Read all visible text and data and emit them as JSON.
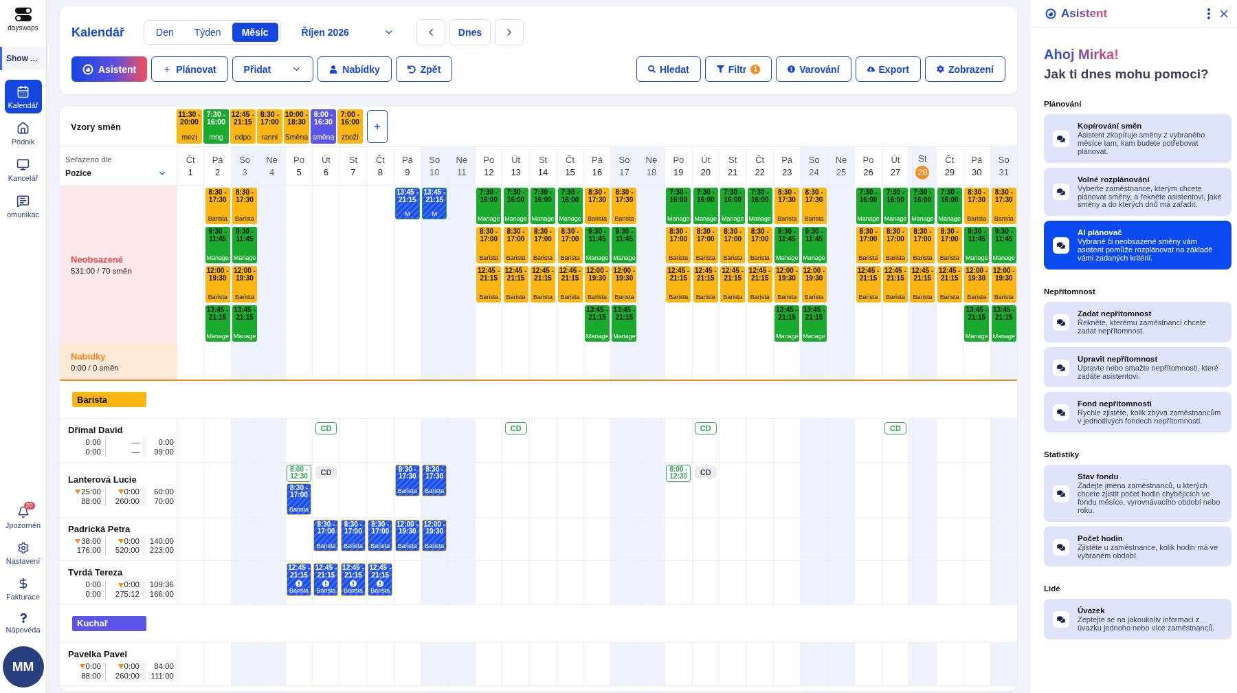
{
  "sidebar": {
    "logo": "dayswaps",
    "workspace": "Show ...",
    "items": [
      {
        "label": "Kalendář",
        "selected": true
      },
      {
        "label": "Podnik",
        "selected": false
      },
      {
        "label": "Kancelář",
        "selected": false
      },
      {
        "label": "omunikac",
        "selected": false
      }
    ],
    "bottom_items": [
      {
        "label": "Jpozorněn",
        "badge": "20"
      },
      {
        "label": "Nastavení"
      },
      {
        "label": "Fakturace"
      },
      {
        "label": "Nápověda"
      }
    ],
    "avatar": "MM"
  },
  "header": {
    "title": "Kalendář",
    "view_tabs": [
      {
        "label": "Den",
        "selected": false
      },
      {
        "label": "Týden",
        "selected": false
      },
      {
        "label": "Měsíc",
        "selected": true
      }
    ],
    "month": "Říjen 2026",
    "today_button": "Dnes",
    "actions_left": [
      {
        "label": "Asistent",
        "kind": "gradient"
      },
      {
        "label": "Plánovat",
        "kind": "plain"
      },
      {
        "label": "Přidat",
        "kind": "dropdown"
      },
      {
        "label": "Nabídky",
        "kind": "plain"
      },
      {
        "label": "Zpět",
        "kind": "plain"
      }
    ],
    "actions_right": [
      {
        "label": "Hledat"
      },
      {
        "label": "Filtr",
        "badge": "1"
      },
      {
        "label": "Varování"
      },
      {
        "label": "Export"
      },
      {
        "label": "Zobrazení"
      }
    ]
  },
  "calendar": {
    "patterns_label": "Vzory směn",
    "patterns": [
      {
        "time": "11:30 - 20:00",
        "name": "mezi",
        "color": "#fbb614"
      },
      {
        "time": "7:30 - 16:00",
        "name": "mng",
        "color": "#1aab2e"
      },
      {
        "time": "12:45 - 21:15",
        "name": "odpo",
        "color": "#fbb614"
      },
      {
        "time": "8:30 - 17:00",
        "name": "ranní",
        "color": "#fbb614"
      },
      {
        "time": "10:00 - 18:30",
        "name": "Směna",
        "color": "#fbb614"
      },
      {
        "time": "8:00 - 16:30",
        "name": "směna",
        "color": "#5b55ea"
      },
      {
        "time": "7:00 - 16:00",
        "name": "zboží",
        "color": "#fbb614"
      }
    ],
    "sort_label": "Seřazeno dle",
    "sort_value": "Pozice",
    "days": [
      {
        "weekday": "Čt",
        "date": "1",
        "weekend": false,
        "today": false
      },
      {
        "weekday": "Pá",
        "date": "2",
        "weekend": false,
        "today": false,
        "unfilled": [
          {
            "kind": "chip",
            "color": "#fbb614",
            "time": "8:30 - 17:30",
            "role": "Barista"
          },
          {
            "kind": "chip",
            "color": "#1aab2e",
            "time": "9:30 - 11:45",
            "role": "Manage"
          },
          {
            "kind": "chip",
            "color": "#fbb614",
            "time": "12:00 - 19:30",
            "role": "Barista"
          },
          {
            "kind": "chip",
            "color": "#1aab2e",
            "time": "13:45 - 21:15",
            "role": "Manage"
          }
        ]
      },
      {
        "weekday": "So",
        "date": "3",
        "weekend": true,
        "today": false,
        "unfilled": [
          {
            "kind": "chip",
            "color": "#fbb614",
            "time": "8:30 - 17:30",
            "role": "Barista"
          },
          {
            "kind": "chip",
            "color": "#1aab2e",
            "time": "9:30 - 11:45",
            "role": "Manage"
          },
          {
            "kind": "chip",
            "color": "#fbb614",
            "time": "12:00 - 19:30",
            "role": "Barista"
          },
          {
            "kind": "chip",
            "color": "#1aab2e",
            "time": "13:45 - 21:15",
            "role": "Manage"
          }
        ]
      },
      {
        "weekday": "Ne",
        "date": "4",
        "weekend": true,
        "today": false
      },
      {
        "weekday": "Po",
        "date": "5",
        "weekend": false,
        "today": false
      },
      {
        "weekday": "Út",
        "date": "6",
        "weekend": false,
        "today": false
      },
      {
        "weekday": "St",
        "date": "7",
        "weekend": false,
        "today": false
      },
      {
        "weekday": "Čt",
        "date": "8",
        "weekend": false,
        "today": false
      },
      {
        "weekday": "Pá",
        "date": "9",
        "weekend": false,
        "today": false,
        "unfilled": [
          {
            "kind": "striped",
            "color": "#19a83a",
            "time": "13:45 - 21:15",
            "role": "M",
            "warning": false
          }
        ]
      },
      {
        "weekday": "So",
        "date": "10",
        "weekend": true,
        "today": false,
        "unfilled": [
          {
            "kind": "striped",
            "color": "#19a83a",
            "time": "13:45 - 21:15",
            "role": "M",
            "warning": false
          }
        ]
      },
      {
        "weekday": "Ne",
        "date": "11",
        "weekend": true,
        "today": false
      },
      {
        "weekday": "Po",
        "date": "12",
        "weekend": false,
        "today": false,
        "unfilled": [
          {
            "kind": "chip",
            "color": "#1aab2e",
            "time": "7:30 - 16:00",
            "role": "Manage"
          },
          {
            "kind": "chip",
            "color": "#fbb614",
            "time": "8:30 - 17:00",
            "role": "Barista"
          },
          {
            "kind": "chip",
            "color": "#fbb614",
            "time": "12:45 - 21:15",
            "role": "Barista"
          }
        ]
      },
      {
        "weekday": "Út",
        "date": "13",
        "weekend": false,
        "today": false,
        "unfilled": [
          {
            "kind": "chip",
            "color": "#1aab2e",
            "time": "7:30 - 16:00",
            "role": "Manage"
          },
          {
            "kind": "chip",
            "color": "#fbb614",
            "time": "8:30 - 17:00",
            "role": "Barista"
          },
          {
            "kind": "chip",
            "color": "#fbb614",
            "time": "12:45 - 21:15",
            "role": "Barista"
          }
        ]
      },
      {
        "weekday": "St",
        "date": "14",
        "weekend": false,
        "today": false,
        "unfilled": [
          {
            "kind": "chip",
            "color": "#1aab2e",
            "time": "7:30 - 16:00",
            "role": "Manage"
          },
          {
            "kind": "chip",
            "color": "#fbb614",
            "time": "8:30 - 17:00",
            "role": "Barista"
          },
          {
            "kind": "chip",
            "color": "#fbb614",
            "time": "12:45 - 21:15",
            "role": "Barista"
          }
        ]
      },
      {
        "weekday": "Čt",
        "date": "15",
        "weekend": false,
        "today": false,
        "unfilled": [
          {
            "kind": "chip",
            "color": "#1aab2e",
            "time": "7:30 - 16:00",
            "role": "Manage"
          },
          {
            "kind": "chip",
            "color": "#fbb614",
            "time": "8:30 - 17:00",
            "role": "Barista"
          },
          {
            "kind": "chip",
            "color": "#fbb614",
            "time": "12:45 - 21:15",
            "role": "Barista"
          }
        ]
      },
      {
        "weekday": "Pá",
        "date": "16",
        "weekend": false,
        "today": false,
        "unfilled": [
          {
            "kind": "chip",
            "color": "#fbb614",
            "time": "8:30 - 17:30",
            "role": "Barista"
          },
          {
            "kind": "chip",
            "color": "#1aab2e",
            "time": "9:30 - 11:45",
            "role": "Manage"
          },
          {
            "kind": "chip",
            "color": "#fbb614",
            "time": "12:00 - 19:30",
            "role": "Barista"
          },
          {
            "kind": "chip",
            "color": "#1aab2e",
            "time": "13:45 - 21:15",
            "role": "Manage"
          }
        ]
      },
      {
        "weekday": "So",
        "date": "17",
        "weekend": true,
        "today": false,
        "unfilled": [
          {
            "kind": "chip",
            "color": "#fbb614",
            "time": "8:30 - 17:30",
            "role": "Barista"
          },
          {
            "kind": "chip",
            "color": "#1aab2e",
            "time": "9:30 - 11:45",
            "role": "Manage"
          },
          {
            "kind": "chip",
            "color": "#fbb614",
            "time": "12:00 - 19:30",
            "role": "Barista"
          },
          {
            "kind": "chip",
            "color": "#1aab2e",
            "time": "13:45 - 21:15",
            "role": "Manage"
          }
        ]
      },
      {
        "weekday": "Ne",
        "date": "18",
        "weekend": true,
        "today": false
      },
      {
        "weekday": "Po",
        "date": "19",
        "weekend": false,
        "today": false,
        "unfilled": [
          {
            "kind": "chip",
            "color": "#1aab2e",
            "time": "7:30 - 16:00",
            "role": "Manage"
          },
          {
            "kind": "chip",
            "color": "#fbb614",
            "time": "8:30 - 17:00",
            "role": "Barista"
          },
          {
            "kind": "chip",
            "color": "#fbb614",
            "time": "12:45 - 21:15",
            "role": "Barista"
          }
        ]
      },
      {
        "weekday": "Út",
        "date": "20",
        "weekend": false,
        "today": false,
        "unfilled": [
          {
            "kind": "chip",
            "color": "#1aab2e",
            "time": "7:30 - 16:00",
            "role": "Manage"
          },
          {
            "kind": "chip",
            "color": "#fbb614",
            "time": "8:30 - 17:00",
            "role": "Barista"
          },
          {
            "kind": "chip",
            "color": "#fbb614",
            "time": "12:45 - 21:15",
            "role": "Barista"
          }
        ]
      },
      {
        "weekday": "St",
        "date": "21",
        "weekend": false,
        "today": false,
        "unfilled": [
          {
            "kind": "chip",
            "color": "#1aab2e",
            "time": "7:30 - 16:00",
            "role": "Manage"
          },
          {
            "kind": "chip",
            "color": "#fbb614",
            "time": "8:30 - 17:00",
            "role": "Barista"
          },
          {
            "kind": "chip",
            "color": "#fbb614",
            "time": "12:45 - 21:15",
            "role": "Barista"
          }
        ]
      },
      {
        "weekday": "Čt",
        "date": "22",
        "weekend": false,
        "today": false,
        "unfilled": [
          {
            "kind": "chip",
            "color": "#1aab2e",
            "time": "7:30 - 16:00",
            "role": "Manage"
          },
          {
            "kind": "chip",
            "color": "#fbb614",
            "time": "8:30 - 17:00",
            "role": "Barista"
          },
          {
            "kind": "chip",
            "color": "#fbb614",
            "time": "12:45 - 21:15",
            "role": "Barista"
          }
        ]
      },
      {
        "weekday": "Pá",
        "date": "23",
        "weekend": false,
        "today": false,
        "unfilled": [
          {
            "kind": "chip",
            "color": "#fbb614",
            "time": "8:30 - 17:30",
            "role": "Barista"
          },
          {
            "kind": "chip",
            "color": "#1aab2e",
            "time": "9:30 - 11:45",
            "role": "Manage"
          },
          {
            "kind": "chip",
            "color": "#fbb614",
            "time": "12:00 - 19:30",
            "role": "Barista"
          },
          {
            "kind": "chip",
            "color": "#1aab2e",
            "time": "13:45 - 21:15",
            "role": "Manage"
          }
        ]
      },
      {
        "weekday": "So",
        "date": "24",
        "weekend": true,
        "today": false,
        "unfilled": [
          {
            "kind": "chip",
            "color": "#fbb614",
            "time": "8:30 - 17:30",
            "role": "Barista"
          },
          {
            "kind": "chip",
            "color": "#1aab2e",
            "time": "9:30 - 11:45",
            "role": "Manage"
          },
          {
            "kind": "chip",
            "color": "#fbb614",
            "time": "12:00 - 19:30",
            "role": "Barista"
          },
          {
            "kind": "chip",
            "color": "#1aab2e",
            "time": "13:45 - 21:15",
            "role": "Manage"
          }
        ]
      },
      {
        "weekday": "Ne",
        "date": "25",
        "weekend": true,
        "today": false
      },
      {
        "weekday": "Po",
        "date": "26",
        "weekend": false,
        "today": false,
        "unfilled": [
          {
            "kind": "chip",
            "color": "#1aab2e",
            "time": "7:30 - 16:00",
            "role": "Manage"
          },
          {
            "kind": "chip",
            "color": "#fbb614",
            "time": "8:30 - 17:00",
            "role": "Barista"
          },
          {
            "kind": "chip",
            "color": "#fbb614",
            "time": "12:45 - 21:15",
            "role": "Barista"
          }
        ]
      },
      {
        "weekday": "Út",
        "date": "27",
        "weekend": false,
        "today": false,
        "unfilled": [
          {
            "kind": "chip",
            "color": "#1aab2e",
            "time": "7:30 - 16:00",
            "role": "Manage"
          },
          {
            "kind": "chip",
            "color": "#fbb614",
            "time": "8:30 - 17:00",
            "role": "Barista"
          },
          {
            "kind": "chip",
            "color": "#fbb614",
            "time": "12:45 - 21:15",
            "role": "Barista"
          }
        ]
      },
      {
        "weekday": "St",
        "date": "28",
        "weekend": false,
        "today": true,
        "unfilled": [
          {
            "kind": "chip",
            "color": "#1aab2e",
            "time": "7:30 - 16:00",
            "role": "Manage"
          },
          {
            "kind": "chip",
            "color": "#fbb614",
            "time": "8:30 - 17:00",
            "role": "Barista"
          },
          {
            "kind": "chip",
            "color": "#fbb614",
            "time": "12:45 - 21:15",
            "role": "Barista"
          }
        ]
      },
      {
        "weekday": "Čt",
        "date": "29",
        "weekend": false,
        "today": false,
        "unfilled": [
          {
            "kind": "chip",
            "color": "#1aab2e",
            "time": "7:30 - 16:00",
            "role": "Manage"
          },
          {
            "kind": "chip",
            "color": "#fbb614",
            "time": "8:30 - 17:00",
            "role": "Barista"
          },
          {
            "kind": "chip",
            "color": "#fbb614",
            "time": "12:45 - 21:15",
            "role": "Barista"
          }
        ]
      },
      {
        "weekday": "Pá",
        "date": "30",
        "weekend": false,
        "today": false,
        "unfilled": [
          {
            "kind": "chip",
            "color": "#fbb614",
            "time": "8:30 - 17:30",
            "role": "Barista"
          },
          {
            "kind": "chip",
            "color": "#1aab2e",
            "time": "9:30 - 11:45",
            "role": "Manage"
          },
          {
            "kind": "chip",
            "color": "#fbb614",
            "time": "12:00 - 19:30",
            "role": "Barista"
          },
          {
            "kind": "chip",
            "color": "#1aab2e",
            "time": "13:45 - 21:15",
            "role": "Manage"
          }
        ]
      },
      {
        "weekday": "So",
        "date": "31",
        "weekend": true,
        "today": false,
        "unfilled": [
          {
            "kind": "chip",
            "color": "#fbb614",
            "time": "8:30 - 17:30",
            "role": "Barista"
          },
          {
            "kind": "chip",
            "color": "#1aab2e",
            "time": "9:30 - 11:45",
            "role": "Manage"
          },
          {
            "kind": "chip",
            "color": "#fbb614",
            "time": "12:00 - 19:30",
            "role": "Barista"
          },
          {
            "kind": "chip",
            "color": "#1aab2e",
            "time": "13:45 - 21:15",
            "role": "Manage"
          }
        ]
      }
    ],
    "unfilled": {
      "title": "Neobsazené",
      "summary": "531:00 / 70 směn"
    },
    "offers": {
      "title": "Nabídky",
      "summary": "0:00 / 0 směn"
    },
    "groups": [
      {
        "name": "Barista",
        "color": "#fbb614",
        "employees": [
          {
            "name": "Dřímal David",
            "stats": [
              {
                "top": "0:00",
                "bottom": "0:00",
                "flag": false
              },
              {
                "top": "—",
                "bottom": "—",
                "flag": false
              },
              {
                "top": "0:00",
                "bottom": "99:00",
                "flag": false
              }
            ],
            "cells": [
              {
                "kind": "free"
              },
              {
                "kind": "free"
              },
              {
                "kind": "free"
              },
              {
                "kind": "free"
              },
              {
                "kind": "free"
              },
              {
                "kind": "busy",
                "items": [
                  {
                    "kind": "badge",
                    "label": "CD",
                    "outlined": true
                  }
                ]
              },
              {
                "kind": "free"
              },
              {
                "kind": "free"
              },
              {
                "kind": "free"
              },
              {
                "kind": "free"
              },
              {
                "kind": "free"
              },
              {
                "kind": "free"
              },
              {
                "kind": "busy",
                "items": [
                  {
                    "kind": "badge",
                    "label": "CD",
                    "outlined": true
                  }
                ]
              },
              {
                "kind": "free"
              },
              {
                "kind": "free"
              },
              {
                "kind": "free"
              },
              {
                "kind": "free"
              },
              {
                "kind": "free"
              },
              {
                "kind": "free"
              },
              {
                "kind": "busy",
                "items": [
                  {
                    "kind": "badge",
                    "label": "CD",
                    "outlined": true
                  }
                ]
              },
              {
                "kind": "free"
              },
              {
                "kind": "free"
              },
              {
                "kind": "free"
              },
              {
                "kind": "free"
              },
              {
                "kind": "free"
              },
              {
                "kind": "free"
              },
              {
                "kind": "busy",
                "items": [
                  {
                    "kind": "badge",
                    "label": "CD",
                    "outlined": true
                  }
                ]
              },
              {
                "kind": "free"
              },
              {
                "kind": "free"
              },
              {
                "kind": "free"
              },
              {
                "kind": "free"
              }
            ]
          },
          {
            "name": "Lanterová Lucie",
            "stats": [
              {
                "top": "25:00",
                "bottom": "88:00",
                "flag": true
              },
              {
                "top": "0:00",
                "bottom": "260:00",
                "flag": true
              },
              {
                "top": "60:00",
                "bottom": "70:00",
                "flag": false
              }
            ],
            "cells": [
              {
                "kind": "free"
              },
              {
                "kind": "free"
              },
              {
                "kind": "free"
              },
              {
                "kind": "free"
              },
              {
                "kind": "busy",
                "items": [
                  {
                    "kind": "outline",
                    "time": "8:00 - 12:30"
                  },
                  {
                    "kind": "striped",
                    "color": "#f5c518",
                    "time": "8:30 - 17:00",
                    "role": "Barista",
                    "warning": false
                  }
                ]
              },
              {
                "kind": "busy",
                "items": [
                  {
                    "kind": "badge",
                    "label": "CD",
                    "outlined": false
                  }
                ]
              },
              {
                "kind": "free"
              },
              {
                "kind": "free"
              },
              {
                "kind": "busy",
                "items": [
                  {
                    "kind": "striped",
                    "color": "#f5c518",
                    "time": "8:30 - 17:30",
                    "role": "Barista",
                    "warning": false
                  }
                ]
              },
              {
                "kind": "busy",
                "items": [
                  {
                    "kind": "striped",
                    "color": "#f5c518",
                    "time": "8:30 - 17:30",
                    "role": "Barista",
                    "warning": false
                  }
                ]
              },
              {
                "kind": "free"
              },
              {
                "kind": "free"
              },
              {
                "kind": "free"
              },
              {
                "kind": "free"
              },
              {
                "kind": "free"
              },
              {
                "kind": "free"
              },
              {
                "kind": "free"
              },
              {
                "kind": "free"
              },
              {
                "kind": "busy",
                "items": [
                  {
                    "kind": "outline",
                    "time": "8:00 - 12:30"
                  }
                ]
              },
              {
                "kind": "busy",
                "items": [
                  {
                    "kind": "badge",
                    "label": "CD",
                    "outlined": false
                  }
                ]
              },
              {
                "kind": "free"
              },
              {
                "kind": "free"
              },
              {
                "kind": "free"
              },
              {
                "kind": "free"
              },
              {
                "kind": "free"
              },
              {
                "kind": "free"
              },
              {
                "kind": "free"
              },
              {
                "kind": "free"
              },
              {
                "kind": "free"
              },
              {
                "kind": "free"
              },
              {
                "kind": "free"
              }
            ]
          },
          {
            "name": "Padrická Petra",
            "stats": [
              {
                "top": "38:00",
                "bottom": "176:00",
                "flag": true
              },
              {
                "top": "0:00",
                "bottom": "520:00",
                "flag": true
              },
              {
                "top": "140:00",
                "bottom": "223:00",
                "flag": false
              }
            ],
            "cells": [
              {
                "kind": "free"
              },
              {
                "kind": "free"
              },
              {
                "kind": "free"
              },
              {
                "kind": "free"
              },
              {
                "kind": "free"
              },
              {
                "kind": "busy",
                "items": [
                  {
                    "kind": "striped",
                    "color": "#f5c518",
                    "time": "8:30 - 17:00",
                    "role": "Barista",
                    "warning": false
                  }
                ]
              },
              {
                "kind": "busy",
                "items": [
                  {
                    "kind": "striped",
                    "color": "#f5c518",
                    "time": "8:30 - 17:00",
                    "role": "Barista",
                    "warning": false
                  }
                ]
              },
              {
                "kind": "busy",
                "items": [
                  {
                    "kind": "striped",
                    "color": "#f5c518",
                    "time": "8:30 - 17:00",
                    "role": "Barista",
                    "warning": false
                  }
                ]
              },
              {
                "kind": "busy",
                "items": [
                  {
                    "kind": "striped",
                    "color": "#f5c518",
                    "time": "12:00 - 19:30",
                    "role": "Barista",
                    "warning": false
                  }
                ]
              },
              {
                "kind": "busy",
                "items": [
                  {
                    "kind": "striped",
                    "color": "#f5c518",
                    "time": "12:00 - 19:30",
                    "role": "Barista",
                    "warning": false
                  }
                ]
              },
              {
                "kind": "free"
              },
              {
                "kind": "free"
              },
              {
                "kind": "free"
              },
              {
                "kind": "free"
              },
              {
                "kind": "free"
              },
              {
                "kind": "free"
              },
              {
                "kind": "free"
              },
              {
                "kind": "free"
              },
              {
                "kind": "free"
              },
              {
                "kind": "free"
              },
              {
                "kind": "free"
              },
              {
                "kind": "free"
              },
              {
                "kind": "free"
              },
              {
                "kind": "free"
              },
              {
                "kind": "free"
              },
              {
                "kind": "free"
              },
              {
                "kind": "free"
              },
              {
                "kind": "free"
              },
              {
                "kind": "free"
              },
              {
                "kind": "free"
              },
              {
                "kind": "free"
              }
            ]
          },
          {
            "name": "Tvrdá Tereza",
            "stats": [
              {
                "top": "0:00",
                "bottom": "0:00",
                "flag": false
              },
              {
                "top": "0:00",
                "bottom": "275:12",
                "flag": true
              },
              {
                "top": "109:36",
                "bottom": "166:00",
                "flag": false
              }
            ],
            "cells": [
              {
                "kind": "free"
              },
              {
                "kind": "free"
              },
              {
                "kind": "free"
              },
              {
                "kind": "free"
              },
              {
                "kind": "busy",
                "items": [
                  {
                    "kind": "striped",
                    "color": "#f5c518",
                    "time": "12:45 - 21:15",
                    "role": "Barista",
                    "warning": true
                  }
                ]
              },
              {
                "kind": "busy",
                "items": [
                  {
                    "kind": "striped",
                    "color": "#f5c518",
                    "time": "12:45 - 21:15",
                    "role": "Barista",
                    "warning": true
                  }
                ]
              },
              {
                "kind": "busy",
                "items": [
                  {
                    "kind": "striped",
                    "color": "#f5c518",
                    "time": "12:45 - 21:15",
                    "role": "Barista",
                    "warning": true
                  }
                ]
              },
              {
                "kind": "busy",
                "items": [
                  {
                    "kind": "striped",
                    "color": "#f5c518",
                    "time": "12:45 - 21:15",
                    "role": "Barista",
                    "warning": true
                  }
                ]
              },
              {
                "kind": "free"
              },
              {
                "kind": "free"
              },
              {
                "kind": "free"
              },
              {
                "kind": "free"
              },
              {
                "kind": "free"
              },
              {
                "kind": "free"
              },
              {
                "kind": "free"
              },
              {
                "kind": "free"
              },
              {
                "kind": "free"
              },
              {
                "kind": "free"
              },
              {
                "kind": "free"
              },
              {
                "kind": "free"
              },
              {
                "kind": "free"
              },
              {
                "kind": "free"
              },
              {
                "kind": "free"
              },
              {
                "kind": "free"
              },
              {
                "kind": "free"
              },
              {
                "kind": "free"
              },
              {
                "kind": "free"
              },
              {
                "kind": "free"
              },
              {
                "kind": "free"
              },
              {
                "kind": "free"
              },
              {
                "kind": "free"
              }
            ]
          }
        ]
      },
      {
        "name": "Kuchař",
        "color": "#5b55ea",
        "employees": [
          {
            "name": "Pavelka Pavel",
            "stats": [
              {
                "top": "0:00",
                "bottom": "88:00",
                "flag": true
              },
              {
                "top": "0:00",
                "bottom": "260:00",
                "flag": true
              },
              {
                "top": "84:00",
                "bottom": "111:00",
                "flag": false
              }
            ],
            "cells": [
              {
                "kind": "free"
              },
              {
                "kind": "free"
              },
              {
                "kind": "free"
              },
              {
                "kind": "free"
              },
              {
                "kind": "free"
              },
              {
                "kind": "free"
              },
              {
                "kind": "free"
              },
              {
                "kind": "free"
              },
              {
                "kind": "free"
              },
              {
                "kind": "free"
              },
              {
                "kind": "free"
              },
              {
                "kind": "free"
              },
              {
                "kind": "free"
              },
              {
                "kind": "free"
              },
              {
                "kind": "free"
              },
              {
                "kind": "free"
              },
              {
                "kind": "free"
              },
              {
                "kind": "free"
              },
              {
                "kind": "free"
              },
              {
                "kind": "free"
              },
              {
                "kind": "free"
              },
              {
                "kind": "free"
              },
              {
                "kind": "free"
              },
              {
                "kind": "free"
              },
              {
                "kind": "free"
              },
              {
                "kind": "free"
              },
              {
                "kind": "free"
              },
              {
                "kind": "free"
              },
              {
                "kind": "free"
              },
              {
                "kind": "free"
              },
              {
                "kind": "free"
              }
            ]
          }
        ]
      }
    ]
  },
  "assistant": {
    "title": "Asistent",
    "greeting": "Ahoj Mirka!",
    "question": "Jak ti dnes mohu pomoci?",
    "sections": [
      {
        "title": "Plánování",
        "cards": [
          {
            "title": "Kopírování směn",
            "text": "Asistent zkopíruje směny z vybraného měsíce tam, kam budete potřebovat plánovat.",
            "selected": false
          },
          {
            "title": "Volné rozplánování",
            "text": "Vyberte zaměstnance, kterým chcete plánovat směny, a řekněte asistentovi, jaké směny a do kterých dnů má zařadit.",
            "selected": false
          },
          {
            "title": "AI plánovač",
            "text": "Vybrané či neobsazené směny vám asistent pomůže rozplánovat na základě vámi zadaných kritérií.",
            "selected": true
          }
        ]
      },
      {
        "title": "Nepřítomnost",
        "cards": [
          {
            "title": "Zadat nepřítomnost",
            "text": "Řekněte, kterému zaměstnanci chcete zadat nepřítomnost.",
            "selected": false
          },
          {
            "title": "Upravit nepřítomnost",
            "text": "Upravte nebo smažte nepřítomnosti, které zadáte asistentovi.",
            "selected": false
          },
          {
            "title": "Fond nepřítomnosti",
            "text": "Rychle zjistěte, kolik zbývá zaměstnancům v jednotlivých fondech nepřítomností.",
            "selected": false
          }
        ]
      },
      {
        "title": "Statistiky",
        "cards": [
          {
            "title": "Stav fondu",
            "text": "Zadejte jména zaměstnanců, u kterých chcete zjistit počet hodin chybějících ve fondu měsíce, vyrovnávacího období nebo roku.",
            "selected": false
          },
          {
            "title": "Počet hodin",
            "text": "Zjistěte u zaměstnance, kolik hodin má ve vybraném období.",
            "selected": false
          }
        ]
      },
      {
        "title": "Lidé",
        "cards": [
          {
            "title": "Úvazek",
            "text": "Zeptejte se na jakoukoliv informaci z úvazku jednoho nebo více zaměstnanců.",
            "selected": false
          }
        ]
      }
    ]
  }
}
